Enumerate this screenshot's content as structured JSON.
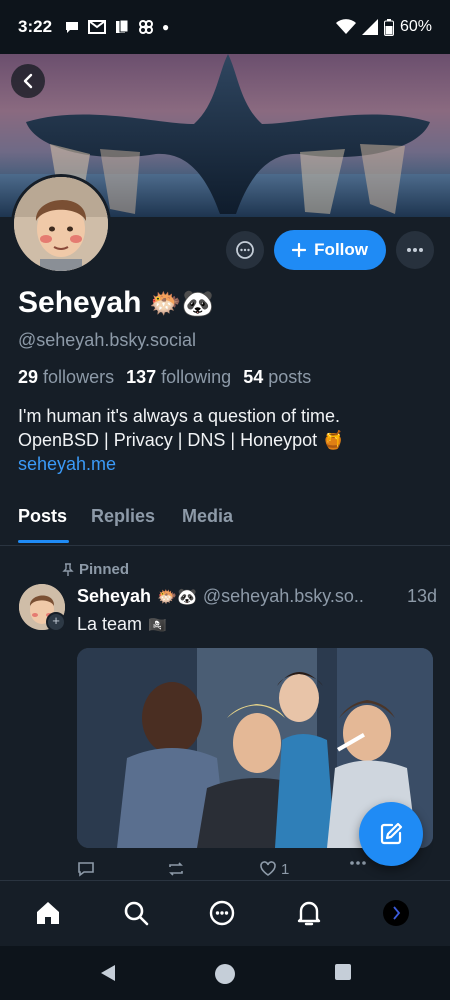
{
  "status": {
    "time": "3:22",
    "battery": "60%",
    "notification_icons": [
      "chat-bubble-icon",
      "gmail-icon",
      "files-icon",
      "pinwheel-icon"
    ]
  },
  "profile": {
    "display_name": "Seheyah",
    "name_emojis": "🐡🐼",
    "handle": "@seheyah.bsky.social",
    "followers_count": "29",
    "followers_label": "followers",
    "following_count": "137",
    "following_label": "following",
    "posts_count": "54",
    "posts_label": "posts",
    "bio_line1": "I'm human it's always a question of time.",
    "bio_line2": "OpenBSD | Privacy | DNS | Honeypot 🍯",
    "bio_link": "seheyah.me",
    "follow_label": "Follow"
  },
  "tabs": [
    {
      "label": "Posts",
      "active": true
    },
    {
      "label": "Replies",
      "active": false
    },
    {
      "label": "Media",
      "active": false
    }
  ],
  "post": {
    "pinned_label": "Pinned",
    "author_name": "Seheyah",
    "author_emojis": "🐡🐼",
    "author_handle": "@seheyah.bsky.so..",
    "time": "13d",
    "text": "La team",
    "text_emoji": "🏴‍☠️",
    "like_count": "1"
  },
  "colors": {
    "accent": "#1f8bf5",
    "background": "#161e27",
    "muted_text": "#8d9aa8"
  }
}
